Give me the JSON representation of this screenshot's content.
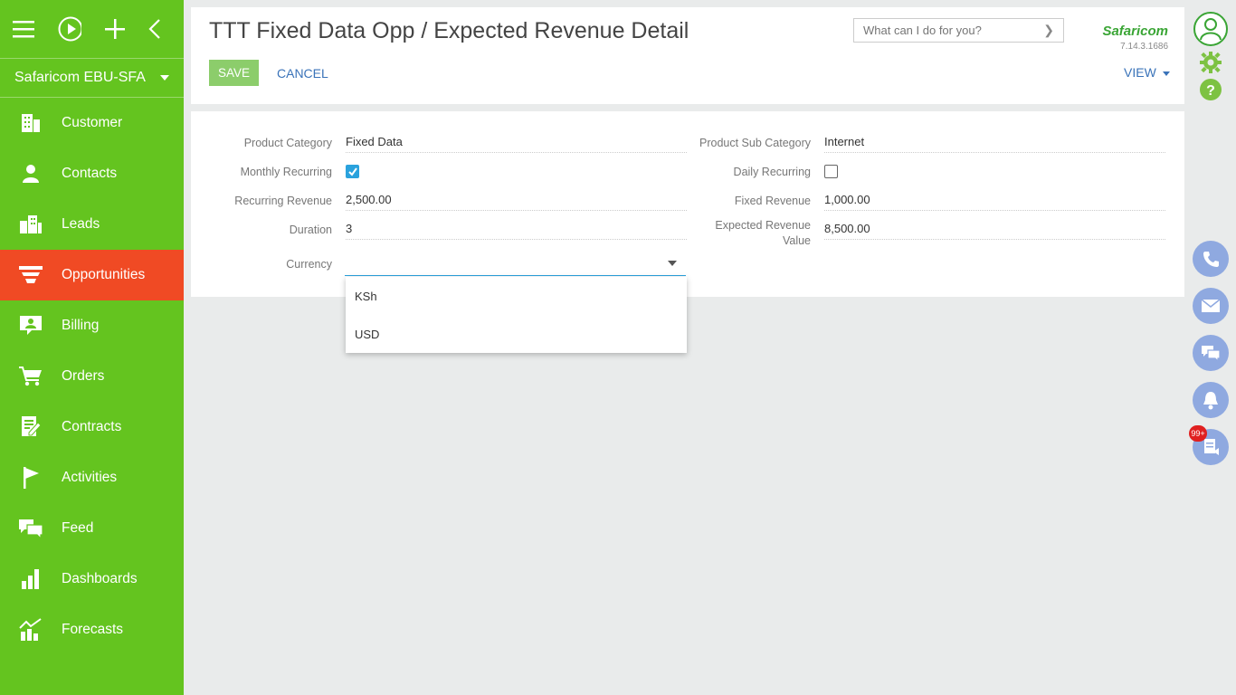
{
  "sidebar": {
    "workspace": "Safaricom EBU-SFA",
    "items": [
      {
        "label": "Customer",
        "icon": "building-icon"
      },
      {
        "label": "Contacts",
        "icon": "person-icon"
      },
      {
        "label": "Leads",
        "icon": "buildings-icon"
      },
      {
        "label": "Opportunities",
        "icon": "funnel-icon"
      },
      {
        "label": "Billing",
        "icon": "billing-icon"
      },
      {
        "label": "Orders",
        "icon": "cart-icon"
      },
      {
        "label": "Contracts",
        "icon": "contract-icon"
      },
      {
        "label": "Activities",
        "icon": "flag-icon"
      },
      {
        "label": "Feed",
        "icon": "chat-icon"
      },
      {
        "label": "Dashboards",
        "icon": "bar-chart-icon"
      },
      {
        "label": "Forecasts",
        "icon": "forecast-icon"
      }
    ],
    "active": "Opportunities"
  },
  "header": {
    "title": "TTT Fixed Data Opp / Expected Revenue Detail",
    "save_label": "SAVE",
    "cancel_label": "CANCEL",
    "view_label": "VIEW",
    "search_placeholder": "What can I do for you?",
    "logo": "Safaricom",
    "version": "7.14.3.1686"
  },
  "form": {
    "product_category_label": "Product Category",
    "product_category_value": "Fixed Data",
    "product_sub_category_label": "Product Sub Category",
    "product_sub_category_value": "Internet",
    "monthly_recurring_label": "Monthly Recurring",
    "monthly_recurring_checked": true,
    "daily_recurring_label": "Daily Recurring",
    "daily_recurring_checked": false,
    "recurring_revenue_label": "Recurring Revenue",
    "recurring_revenue_value": "2,500.00",
    "fixed_revenue_label": "Fixed Revenue",
    "fixed_revenue_value": "1,000.00",
    "duration_label": "Duration",
    "duration_value": "3",
    "expected_revenue_label_1": "Expected Revenue",
    "expected_revenue_label_2": "Value",
    "expected_revenue_value": "8,500.00",
    "currency_label": "Currency",
    "currency_value": "",
    "currency_options": [
      "KSh",
      "USD"
    ]
  },
  "rightbar": {
    "notification_badge": "99+"
  },
  "colors": {
    "sidebar": "#64c41f",
    "active_item": "#f04a24",
    "accent_blue": "#2aa2dd",
    "link_blue": "#3a73b9",
    "save_green": "#8ccd6b"
  }
}
